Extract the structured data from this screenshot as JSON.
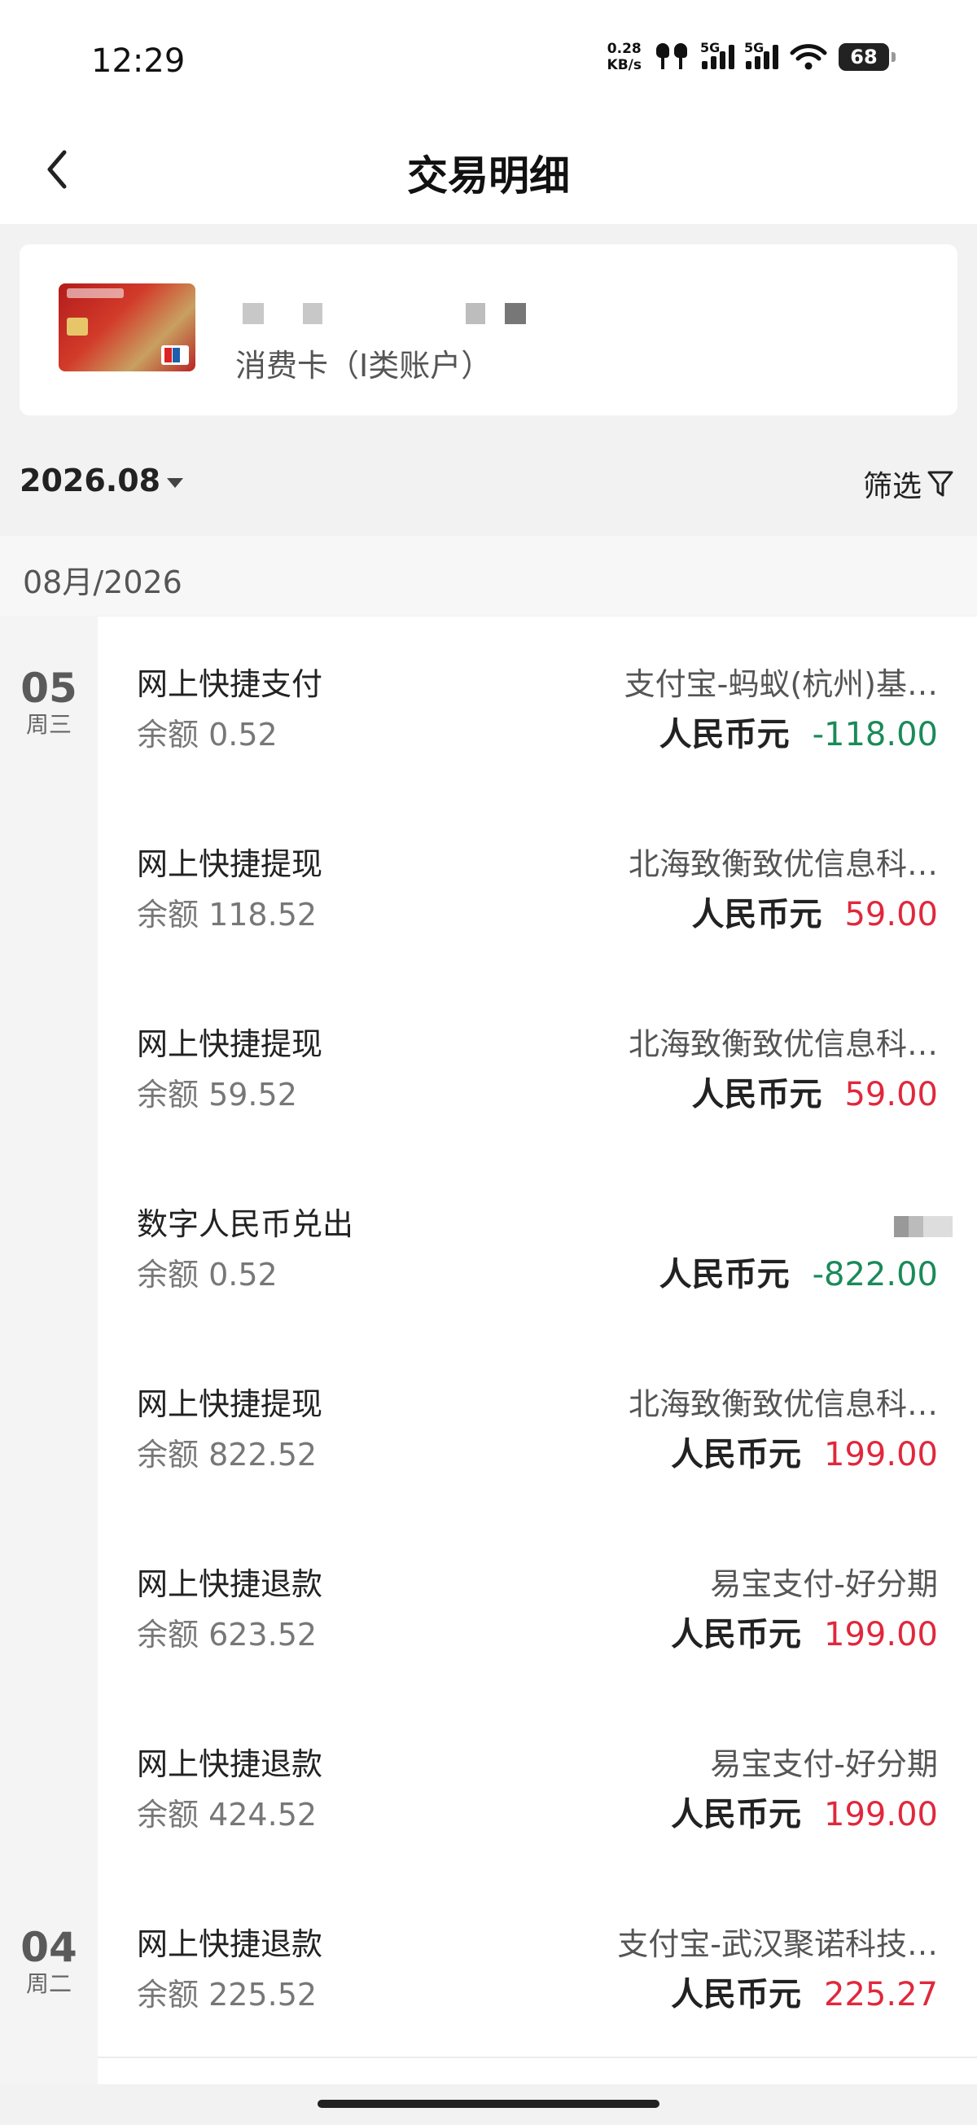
{
  "status": {
    "time": "12:29",
    "net_speed_top": "0.28",
    "net_speed_bottom": "KB/s",
    "sig1": "5G",
    "sig2": "5G",
    "battery": "68"
  },
  "header": {
    "title": "交易明细"
  },
  "card": {
    "type_label": "消费卡（I类账户）"
  },
  "filter": {
    "month": "2026.08",
    "filter_label": "筛选"
  },
  "group": {
    "label": "08月/2026"
  },
  "dates": [
    {
      "day": "05",
      "weekday": "周三"
    },
    {
      "day": "04",
      "weekday": "周二"
    }
  ],
  "transactions": [
    {
      "type": "网上快捷支付",
      "balance": "余额 0.52",
      "counterparty": "支付宝-蚂蚁(杭州)基…",
      "currency": "人民币元",
      "amount": "-118.00",
      "sign": "neg"
    },
    {
      "type": "网上快捷提现",
      "balance": "余额 118.52",
      "counterparty": "北海致衡致优信息科…",
      "currency": "人民币元",
      "amount": "59.00",
      "sign": "pos"
    },
    {
      "type": "网上快捷提现",
      "balance": "余额 59.52",
      "counterparty": "北海致衡致优信息科…",
      "currency": "人民币元",
      "amount": "59.00",
      "sign": "pos"
    },
    {
      "type": "数字人民币兑出",
      "balance": "余额 0.52",
      "counterparty": "",
      "currency": "人民币元",
      "amount": "-822.00",
      "sign": "neg"
    },
    {
      "type": "网上快捷提现",
      "balance": "余额 822.52",
      "counterparty": "北海致衡致优信息科…",
      "currency": "人民币元",
      "amount": "199.00",
      "sign": "pos"
    },
    {
      "type": "网上快捷退款",
      "balance": "余额 623.52",
      "counterparty": "易宝支付-好分期",
      "currency": "人民币元",
      "amount": "199.00",
      "sign": "pos"
    },
    {
      "type": "网上快捷退款",
      "balance": "余额 424.52",
      "counterparty": "易宝支付-好分期",
      "currency": "人民币元",
      "amount": "199.00",
      "sign": "pos"
    },
    {
      "type": "网上快捷退款",
      "balance": "余额 225.52",
      "counterparty": "支付宝-武汉聚诺科技…",
      "currency": "人民币元",
      "amount": "225.27",
      "sign": "pos"
    }
  ],
  "colors": {
    "negative": "#1a8a5a",
    "positive": "#e0283c"
  }
}
